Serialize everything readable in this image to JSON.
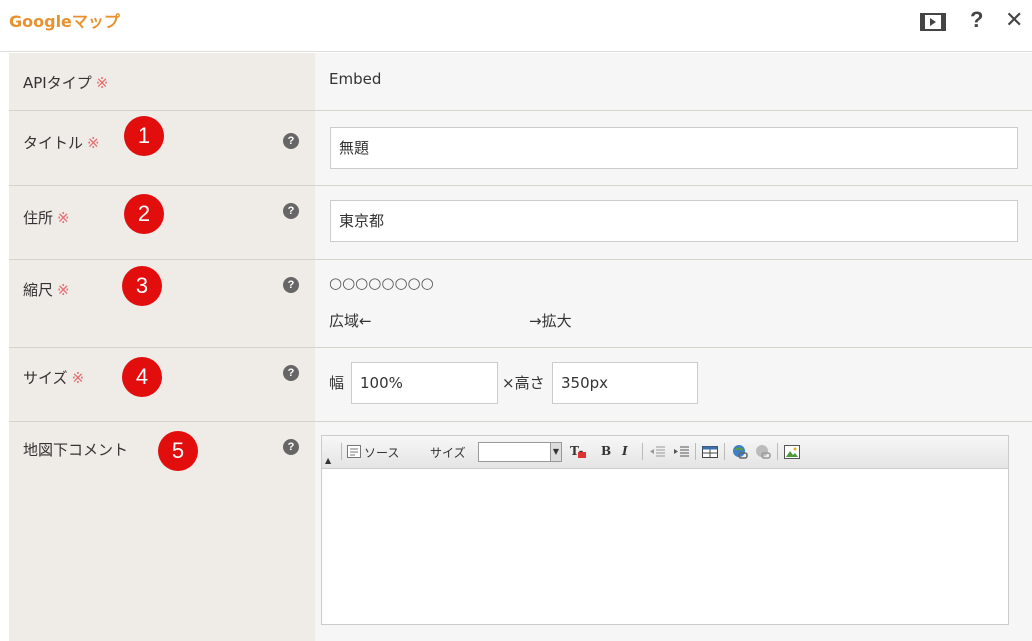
{
  "header": {
    "title": "Googleマップ",
    "help_glyph": "?",
    "close_glyph": "✕"
  },
  "required_mark": "※",
  "help_glyph": "?",
  "rows": {
    "api_type": {
      "label": "APIタイプ",
      "value": "Embed"
    },
    "title": {
      "label": "タイトル",
      "badge": "1",
      "value": "無題"
    },
    "address": {
      "label": "住所",
      "badge": "2",
      "value": "東京都"
    },
    "scale": {
      "label": "縮尺",
      "badge": "3",
      "radios": "○○○○○○○○",
      "wide_label": "広域←",
      "zoom_label": "→拡大"
    },
    "size": {
      "label": "サイズ",
      "badge": "4",
      "width_label": "幅",
      "width_value": "100%",
      "height_label": "×高さ",
      "height_value": "350px"
    },
    "comment": {
      "label": "地図下コメント",
      "badge": "5"
    }
  },
  "toolbar": {
    "source_label": "ソース",
    "size_label": "サイズ",
    "size_value": "",
    "bold_label": "B",
    "italic_label": "I"
  },
  "colors": {
    "title": "#e8922f",
    "badge": "#e20d0d",
    "required": "#e76b6b",
    "label_bg": "#efebe6",
    "value_bg": "#f6f6f6"
  }
}
